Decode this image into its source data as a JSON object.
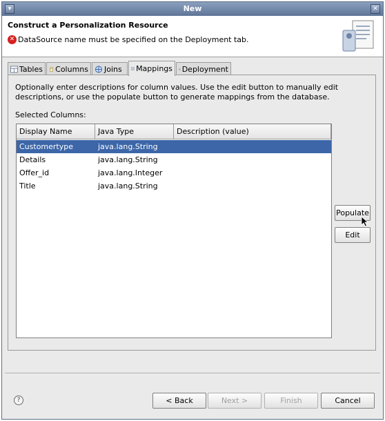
{
  "window": {
    "title": "New"
  },
  "header": {
    "title": "Construct a Personalization Resource",
    "message": "DataSource name must be specified on the Deployment tab."
  },
  "tabs": [
    {
      "label": "Tables"
    },
    {
      "label": "Columns"
    },
    {
      "label": "Joins"
    },
    {
      "label": "Mappings"
    },
    {
      "label": "Deployment"
    }
  ],
  "mappings": {
    "instructions": "Optionally enter descriptions for column values.  Use the edit button to manually edit descriptions, or use the populate button to generate mappings from the database.",
    "selected_columns_label": "Selected Columns:",
    "columns": [
      "Display Name",
      "Java Type",
      "Description (value)"
    ],
    "rows": [
      {
        "display_name": "Customertype",
        "java_type": "java.lang.String",
        "description": ""
      },
      {
        "display_name": "Details",
        "java_type": "java.lang.String",
        "description": ""
      },
      {
        "display_name": "Offer_id",
        "java_type": "java.lang.Integer",
        "description": ""
      },
      {
        "display_name": "Title",
        "java_type": "java.lang.String",
        "description": ""
      }
    ],
    "populate_label": "Populate",
    "edit_label": "Edit"
  },
  "buttons": {
    "back": "< Back",
    "next": "Next >",
    "finish": "Finish",
    "cancel": "Cancel"
  },
  "colors": {
    "selection": "#3c66a8",
    "titlebar": "#6f84a5",
    "error": "#d62020"
  }
}
